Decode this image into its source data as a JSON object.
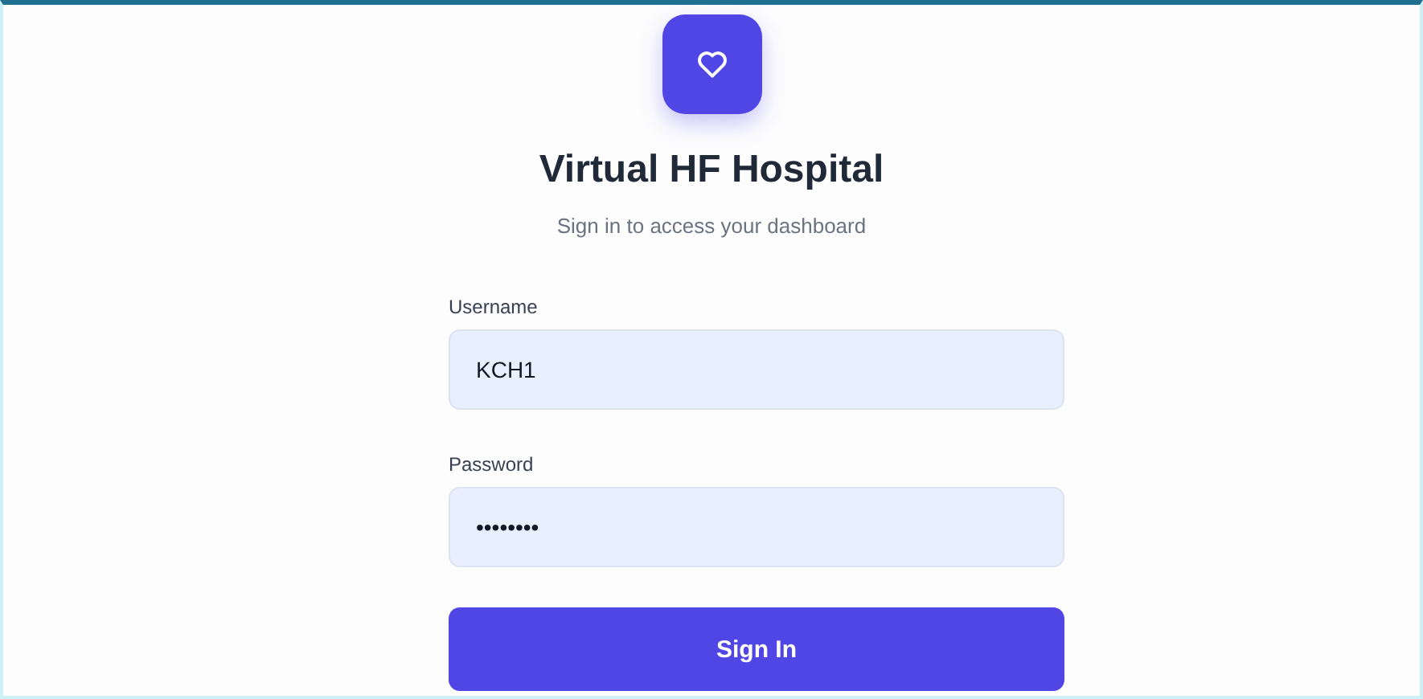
{
  "brand": {
    "title": "Virtual HF Hospital",
    "subtitle": "Sign in to access your dashboard"
  },
  "fields": [
    {
      "label": "Username",
      "value": "KCH1"
    },
    {
      "label": "Password",
      "value": "••••••••"
    }
  ],
  "submit": "Sign In"
}
